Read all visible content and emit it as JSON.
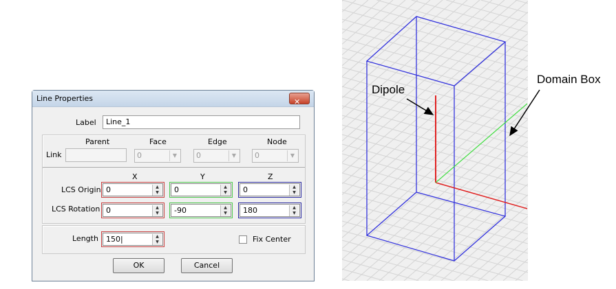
{
  "dialog": {
    "title": "Line Properties",
    "close_icon": "close-icon",
    "label": {
      "caption": "Label",
      "value": "Line_1"
    },
    "link": {
      "caption": "Link",
      "headers": [
        "Parent",
        "Face",
        "Edge",
        "Node"
      ],
      "parent_value": "",
      "face": "0",
      "edge": "0",
      "node": "0"
    },
    "axes": [
      "X",
      "Y",
      "Z"
    ],
    "lcs_origin": {
      "caption": "LCS Origin",
      "values": [
        "0",
        "0",
        "0"
      ]
    },
    "lcs_rotation": {
      "caption": "LCS Rotation",
      "values": [
        "0",
        "-90",
        "180"
      ]
    },
    "length": {
      "caption": "Length",
      "value": "150"
    },
    "fix_center": {
      "caption": "Fix Center",
      "checked": false
    },
    "ok": "OK",
    "cancel": "Cancel",
    "axis_colors": {
      "x": "#c84040",
      "y": "#4cc84c",
      "z": "#2a2aa0"
    }
  },
  "view": {
    "dipole_label": "Dipole",
    "domain_box_label": "Domain Box"
  }
}
